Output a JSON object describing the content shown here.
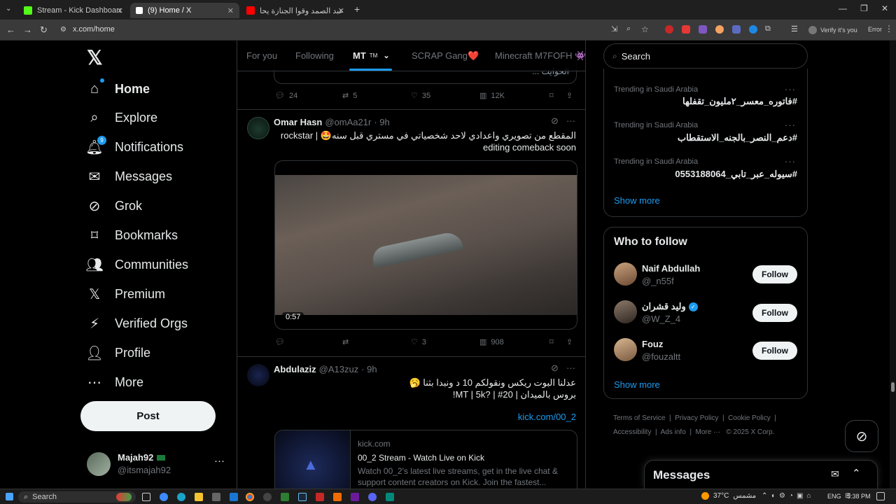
{
  "browser": {
    "tabs": [
      {
        "label": "Stream - Kick Dashboard",
        "color": "#53fc18"
      },
      {
        "label": "(9) Home / X",
        "color": "#ffffff"
      },
      {
        "label": "عبد الصمد وقوا الجنازة يحاولون",
        "color": "#ff0000"
      }
    ],
    "url": "x.com/home",
    "verify_text": "Verify it's you",
    "error_text": "Error"
  },
  "nav": {
    "items": [
      {
        "label": "Home",
        "icon": "home-icon"
      },
      {
        "label": "Explore",
        "icon": "search-icon"
      },
      {
        "label": "Notifications",
        "icon": "bell-icon",
        "badge": "9"
      },
      {
        "label": "Messages",
        "icon": "mail-icon"
      },
      {
        "label": "Grok",
        "icon": "grok-icon"
      },
      {
        "label": "Bookmarks",
        "icon": "bookmark-icon"
      },
      {
        "label": "Communities",
        "icon": "communities-icon"
      },
      {
        "label": "Premium",
        "icon": "x-logo-icon"
      },
      {
        "label": "Verified Orgs",
        "icon": "lightning-icon"
      },
      {
        "label": "Profile",
        "icon": "person-icon"
      },
      {
        "label": "More",
        "icon": "more-circle-icon"
      }
    ],
    "post_label": "Post",
    "account": {
      "name": "Majah92",
      "handle": "@itsmajah92"
    }
  },
  "feed_tabs": [
    {
      "label": "For you"
    },
    {
      "label": "Following"
    },
    {
      "label": "MT"
    },
    {
      "label": "SCRAP Gang❤️"
    },
    {
      "label": "Minecraft M7FOFH 👾"
    }
  ],
  "feed_tab_suffix": "TM",
  "prev_tweet": {
    "snippet": "الحوايت ...",
    "replies": "24",
    "reposts": "5",
    "likes": "35",
    "views": "12K"
  },
  "tweet1": {
    "name": "Omar Hasn",
    "handle": "@omAa21r",
    "time": "· 9h",
    "text_line1": "المقطع من تصويري واعدادي لاحد شخصياتي في مستري قبل سنه🤩 | rockstar",
    "text_line2": "editing comeback soon",
    "video_duration": "0:57",
    "replies": "",
    "reposts": "",
    "likes": "3",
    "views": "908"
  },
  "tweet2": {
    "name": "Abdulaziz",
    "handle": "@A13zuz",
    "time": "· 9h",
    "text_line1": "عدلنا البوت ريكس ونقولكم 10 د ونبدا بثنا 🥱",
    "text_line2": "بروس بالميدان | MT | 5k? | #20!",
    "link": "kick.com/00_2",
    "card_domain": "kick.com",
    "card_title": "00_2 Stream - Watch Live on Kick",
    "card_desc": "Watch 00_2's latest live streams, get in the live chat & support content creators on Kick. Join the fastest..."
  },
  "search": {
    "placeholder": "Search"
  },
  "trends": [
    {
      "meta": "Trending in Saudi Arabia",
      "tag": "#فاتوره_معسر_٢مليون_تقفلها"
    },
    {
      "meta": "Trending in Saudi Arabia",
      "tag": "#دعم_النصر_بالجنه_الاستقطاب"
    },
    {
      "meta": "Trending in Saudi Arabia",
      "tag": "#سيوله_عبر_تابي_0553188064"
    }
  ],
  "trends_show_more": "Show more",
  "who_to_follow": {
    "title": "Who to follow",
    "users": [
      {
        "name": "Naif Abdullah",
        "handle": "@_n55f",
        "button": "Follow"
      },
      {
        "name": "وليد قشران",
        "handle": "@W_Z_4",
        "button": "Follow",
        "verified": true
      },
      {
        "name": "Fouz",
        "handle": "@fouzaltt",
        "button": "Follow"
      }
    ],
    "show_more": "Show more"
  },
  "footer": {
    "links": [
      "Terms of Service",
      "Privacy Policy",
      "Cookie Policy",
      "Accessibility",
      "Ads info",
      "More ···"
    ],
    "copyright": "© 2025 X Corp."
  },
  "messages_drawer": {
    "title": "Messages"
  },
  "taskbar": {
    "search": "Search",
    "weather": "37°C",
    "weather_label": "مشمس",
    "lang": "ENG",
    "time": "5:38 PM"
  }
}
